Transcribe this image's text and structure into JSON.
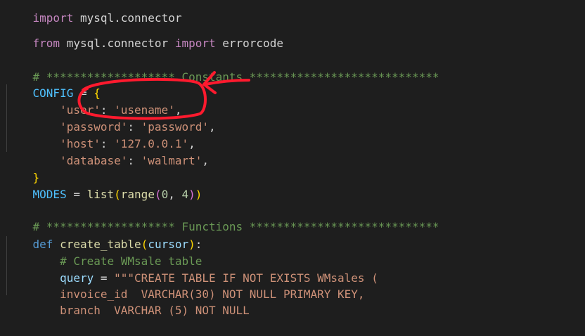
{
  "code": {
    "l1": {
      "kw": "import",
      "mod": " mysql.connector"
    },
    "l2": {
      "kw1": "from",
      "mod": " mysql.connector ",
      "kw2": "import",
      "name": " errorcode"
    },
    "l3": {
      "comment": "# ******************* Constants ****************************"
    },
    "l4": {
      "name": "CONFIG",
      "op": " = ",
      "brace": "{"
    },
    "l5": {
      "indent": "    ",
      "key": "'user'",
      "colon": ": ",
      "val": "'usename'",
      "comma": ","
    },
    "l6": {
      "indent": "    ",
      "key": "'password'",
      "colon": ": ",
      "val": "'password'",
      "comma": ","
    },
    "l7": {
      "indent": "    ",
      "key": "'host'",
      "colon": ": ",
      "val": "'127.0.0.1'",
      "comma": ","
    },
    "l8": {
      "indent": "    ",
      "key": "'database'",
      "colon": ": ",
      "val": "'walmart'",
      "comma": ","
    },
    "l9": {
      "brace": "}"
    },
    "l10": {
      "name": "MODES",
      "op": " = ",
      "fn1": "list",
      "p1": "(",
      "fn2": "range",
      "p2": "(",
      "n1": "0",
      "sep": ", ",
      "n2": "4",
      "p3": ")",
      "p4": ")"
    },
    "l11": {
      "comment": "# ******************* Functions ****************************"
    },
    "l12": {
      "kw": "def",
      "sp": " ",
      "fn": "create_table",
      "p1": "(",
      "param": "cursor",
      "p2": ")",
      "colon": ":"
    },
    "l13": {
      "indent": "    ",
      "comment": "# Create WMsale table"
    },
    "l14": {
      "indent": "    ",
      "var": "query",
      "op": " = ",
      "str": "\"\"\"CREATE TABLE IF NOT EXISTS WMsales ("
    },
    "l15": {
      "indent": "    ",
      "str": "invoice_id  VARCHAR(30) NOT NULL PRIMARY KEY,"
    },
    "l16": {
      "indent": "    ",
      "str": "branch  VARCHAR (5) NOT NULL"
    }
  },
  "colors": {
    "background": "#1e1e1e",
    "annotation": "#ff1a2e"
  }
}
